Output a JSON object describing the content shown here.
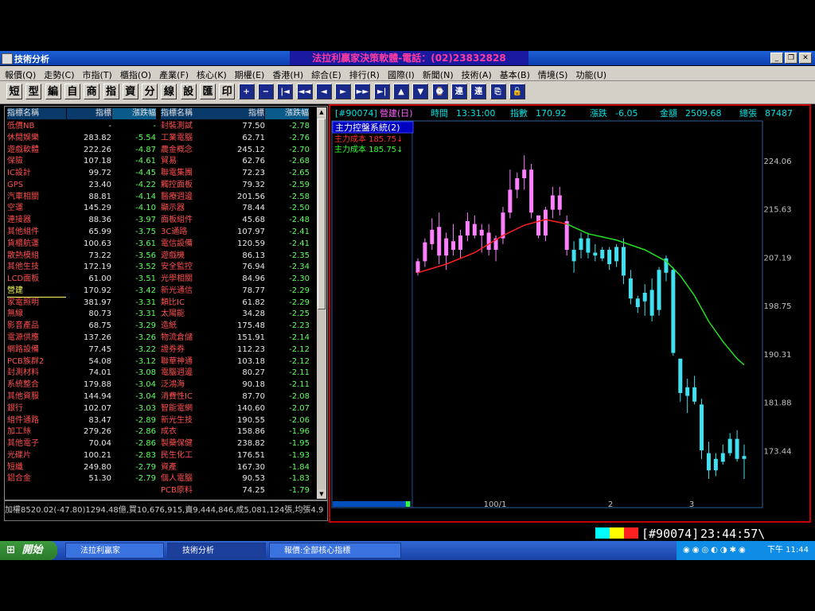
{
  "window": {
    "title": "技術分析",
    "center_title": "法拉利贏家決策軟體-電話：(02)23832828"
  },
  "menu": [
    "報價(Q)",
    "走勢(C)",
    "市指(T)",
    "櫃指(O)",
    "產業(F)",
    "核心(K)",
    "期權(E)",
    "香港(H)",
    "綜合(E)",
    "排行(R)",
    "國際(I)",
    "新聞(N)",
    "技術(A)",
    "基本(B)",
    "情境(S)",
    "功能(U)"
  ],
  "toolbar": [
    "短",
    "型",
    "編",
    "自",
    "商",
    "指",
    "資",
    "分",
    "線",
    "設",
    "匯",
    "印",
    "+",
    "−",
    "|◄",
    "◄◄",
    "◄",
    "►",
    "►►",
    "►|",
    "▲",
    "▼",
    "⌚",
    "連",
    "連",
    "⎘",
    "🔓"
  ],
  "list": {
    "headers": [
      "指標名稱",
      "指標",
      "漲跌幅",
      "指標名稱",
      "指標",
      "漲跌幅"
    ],
    "left": [
      [
        "低價NB",
        "-",
        "-"
      ],
      [
        "休閒娛樂",
        "283.82",
        "-5.54"
      ],
      [
        "遊戲軟體",
        "222.26",
        "-4.87"
      ],
      [
        "保險",
        "107.18",
        "-4.61"
      ],
      [
        "IC設計",
        "99.72",
        "-4.45"
      ],
      [
        "GPS",
        "23.40",
        "-4.22"
      ],
      [
        "汽車相關",
        "88.81",
        "-4.14"
      ],
      [
        "空運",
        "145.29",
        "-4.10"
      ],
      [
        "連接器",
        "88.36",
        "-3.97"
      ],
      [
        "其他組件",
        "65.99",
        "-3.75"
      ],
      [
        "貨櫃航運",
        "100.63",
        "-3.61"
      ],
      [
        "散熱模組",
        "73.22",
        "-3.56"
      ],
      [
        "其他生技",
        "172.19",
        "-3.52"
      ],
      [
        "LCD面板",
        "61.00",
        "-3.51"
      ],
      [
        "營建",
        "170.92",
        "-3.42"
      ],
      [
        "家電照明",
        "381.97",
        "-3.31"
      ],
      [
        "無線",
        "80.73",
        "-3.31"
      ],
      [
        "影音產品",
        "68.75",
        "-3.29"
      ],
      [
        "電源供應",
        "137.26",
        "-3.26"
      ],
      [
        "網路設備",
        "77.45",
        "-3.22"
      ],
      [
        "PCB族群2",
        "54.08",
        "-3.12"
      ],
      [
        "封測材料",
        "74.01",
        "-3.08"
      ],
      [
        "系統整合",
        "179.88",
        "-3.04"
      ],
      [
        "其他資服",
        "144.94",
        "-3.04"
      ],
      [
        "銀行",
        "102.07",
        "-3.03"
      ],
      [
        "組件通路",
        "83.47",
        "-2.89"
      ],
      [
        "加工絲",
        "279.26",
        "-2.86"
      ],
      [
        "其他電子",
        "70.04",
        "-2.86"
      ],
      [
        "光碟片",
        "100.21",
        "-2.83"
      ],
      [
        "短纖",
        "249.80",
        "-2.79"
      ],
      [
        "鋁合金",
        "51.30",
        "-2.79"
      ]
    ],
    "right": [
      [
        "封裝測試",
        "77.50",
        "-2.78"
      ],
      [
        "工業電腦",
        "62.71",
        "-2.76"
      ],
      [
        "農金概念",
        "245.12",
        "-2.70"
      ],
      [
        "貿易",
        "62.76",
        "-2.68"
      ],
      [
        "聯電集團",
        "72.23",
        "-2.65"
      ],
      [
        "觸控面板",
        "79.32",
        "-2.59"
      ],
      [
        "醫療週邊",
        "201.56",
        "-2.58"
      ],
      [
        "顯示器",
        "78.44",
        "-2.50"
      ],
      [
        "面板組件",
        "45.68",
        "-2.48"
      ],
      [
        "3C通路",
        "107.97",
        "-2.41"
      ],
      [
        "電信設備",
        "120.59",
        "-2.41"
      ],
      [
        "遊戲機",
        "86.13",
        "-2.35"
      ],
      [
        "安全監控",
        "76.94",
        "-2.34"
      ],
      [
        "光學相關",
        "84.96",
        "-2.30"
      ],
      [
        "新光通信",
        "78.77",
        "-2.29"
      ],
      [
        "類比IC",
        "61.82",
        "-2.29"
      ],
      [
        "太陽能",
        "34.28",
        "-2.25"
      ],
      [
        "造紙",
        "175.48",
        "-2.23"
      ],
      [
        "物流倉儲",
        "151.91",
        "-2.14"
      ],
      [
        "證券券",
        "112.23",
        "-2.12"
      ],
      [
        "聯華神通",
        "103.18",
        "-2.12"
      ],
      [
        "電腦週邊",
        "80.27",
        "-2.11"
      ],
      [
        "泛鴻海",
        "90.18",
        "-2.11"
      ],
      [
        "消費性IC",
        "87.70",
        "-2.08"
      ],
      [
        "智能電網",
        "140.60",
        "-2.07"
      ],
      [
        "新光生技",
        "190.55",
        "-2.06"
      ],
      [
        "成衣",
        "158.86",
        "-1.96"
      ],
      [
        "製藥保健",
        "238.82",
        "-1.95"
      ],
      [
        "民生化工",
        "176.51",
        "-1.93"
      ],
      [
        "資產",
        "167.30",
        "-1.84"
      ],
      [
        "個人電腦",
        "90.53",
        "-1.83"
      ],
      [
        "PCB原料",
        "74.25",
        "-1.79"
      ]
    ],
    "status": "加權8520.02(-47.80)1294.48億,買10,676,915,賣9,444,846,成5,081,124張,均張4.9"
  },
  "chart_header": {
    "code": "[#90074]",
    "name": "營建(日)",
    "time_label": "時間",
    "time": "13:31:00",
    "index_label": "指數",
    "index": "170.92",
    "change_label": "漲跌",
    "change": "-6.05",
    "amount_label": "金額",
    "amount": "2509.68",
    "volume_label": "總張",
    "volume": "87487"
  },
  "indicator": {
    "title": "主力控盤系統(2)",
    "line1": "主力成本 185.75↓",
    "line2": "主力成本 185.75↓"
  },
  "chart_data": {
    "type": "candlestick",
    "ylim": [
      166,
      231
    ],
    "yticks": [
      "224.06",
      "215.63",
      "207.19",
      "198.75",
      "190.31",
      "181.88",
      "173.44"
    ],
    "xlabels": [
      "100/1",
      "2",
      "3"
    ],
    "candles": [
      [
        204.5,
        207.0,
        204.0,
        206.5
      ],
      [
        206.5,
        210.5,
        205.5,
        209.8
      ],
      [
        209.5,
        214.0,
        208.5,
        212.0
      ],
      [
        212.5,
        215.0,
        206.0,
        207.5
      ],
      [
        207.5,
        211.5,
        205.0,
        210.5
      ],
      [
        210.0,
        213.0,
        207.5,
        208.5
      ],
      [
        208.5,
        212.0,
        207.0,
        211.0
      ],
      [
        211.0,
        215.0,
        210.0,
        213.5
      ],
      [
        213.0,
        214.5,
        210.5,
        211.0
      ],
      [
        211.0,
        213.0,
        208.0,
        212.0
      ],
      [
        211.5,
        213.0,
        207.5,
        208.5
      ],
      [
        208.5,
        211.0,
        206.5,
        210.5
      ],
      [
        210.5,
        216.0,
        209.5,
        215.0
      ],
      [
        215.0,
        222.5,
        214.0,
        219.0
      ],
      [
        219.0,
        222.0,
        217.5,
        221.0
      ],
      [
        221.0,
        225.0,
        219.0,
        222.5
      ],
      [
        222.5,
        223.5,
        214.0,
        215.0
      ],
      [
        214.5,
        214.5,
        210.5,
        211.0
      ],
      [
        211.0,
        216.0,
        210.0,
        215.5
      ],
      [
        215.5,
        219.5,
        214.0,
        218.0
      ],
      [
        218.0,
        219.5,
        214.5,
        215.5
      ],
      [
        213.5,
        214.5,
        207.5,
        208.5
      ],
      [
        206.5,
        210.0,
        204.5,
        208.5
      ],
      [
        208.5,
        211.5,
        207.0,
        210.5
      ],
      [
        210.5,
        211.5,
        207.0,
        208.0
      ],
      [
        208.0,
        209.5,
        206.5,
        207.5
      ],
      [
        207.0,
        209.0,
        206.5,
        208.5
      ],
      [
        208.5,
        209.0,
        205.0,
        206.0
      ],
      [
        206.5,
        209.5,
        205.5,
        209.0
      ],
      [
        209.0,
        210.5,
        202.5,
        204.0
      ],
      [
        203.5,
        205.0,
        199.0,
        200.0
      ],
      [
        200.0,
        200.5,
        197.5,
        198.5
      ],
      [
        199.5,
        202.5,
        197.0,
        201.0
      ],
      [
        201.5,
        203.5,
        196.0,
        197.0
      ],
      [
        198.0,
        205.5,
        197.0,
        205.0
      ],
      [
        204.5,
        207.5,
        203.0,
        207.0
      ],
      [
        205.0,
        205.5,
        190.0,
        190.5
      ],
      [
        189.5,
        189.5,
        182.0,
        183.5
      ],
      [
        183.0,
        186.0,
        180.0,
        184.5
      ],
      [
        184.5,
        186.5,
        181.5,
        182.0
      ],
      [
        181.5,
        182.5,
        172.0,
        173.5
      ],
      [
        173.0,
        175.0,
        168.5,
        170.0
      ],
      [
        170.0,
        173.0,
        169.0,
        172.0
      ],
      [
        171.5,
        174.5,
        171.0,
        173.0
      ],
      [
        173.0,
        176.5,
        172.5,
        175.5
      ],
      [
        175.5,
        177.0,
        171.5,
        172.0
      ],
      [
        172.5,
        174.5,
        168.5,
        172.0
      ]
    ],
    "ma": [
      [
        0,
        204.5
      ],
      [
        4,
        206.0
      ],
      [
        8,
        208.0
      ],
      [
        12,
        211.0
      ],
      [
        15,
        212.8
      ],
      [
        18,
        213.8
      ],
      [
        21,
        213.0
      ],
      [
        24,
        211.3
      ],
      [
        28,
        210.2
      ],
      [
        32,
        208.5
      ],
      [
        35,
        206.5
      ],
      [
        37,
        204.0
      ],
      [
        39,
        200.5
      ],
      [
        41,
        196.0
      ],
      [
        43,
        192.5
      ],
      [
        45,
        189.5
      ],
      [
        46,
        188.4
      ]
    ],
    "split_index": 21,
    "colors": {
      "up": "#ff80ff",
      "down": "#40e0f0",
      "ma_up": "#ff2020",
      "ma_down": "#20e020"
    }
  },
  "chart_status": {
    "code": "[#90074]",
    "time": "23:44:57\\"
  },
  "taskbar": {
    "start": "開始",
    "tasks": [
      "法拉利贏家",
      "技術分析",
      "報價:全部核心指標"
    ],
    "clock": "下午 11:44"
  }
}
